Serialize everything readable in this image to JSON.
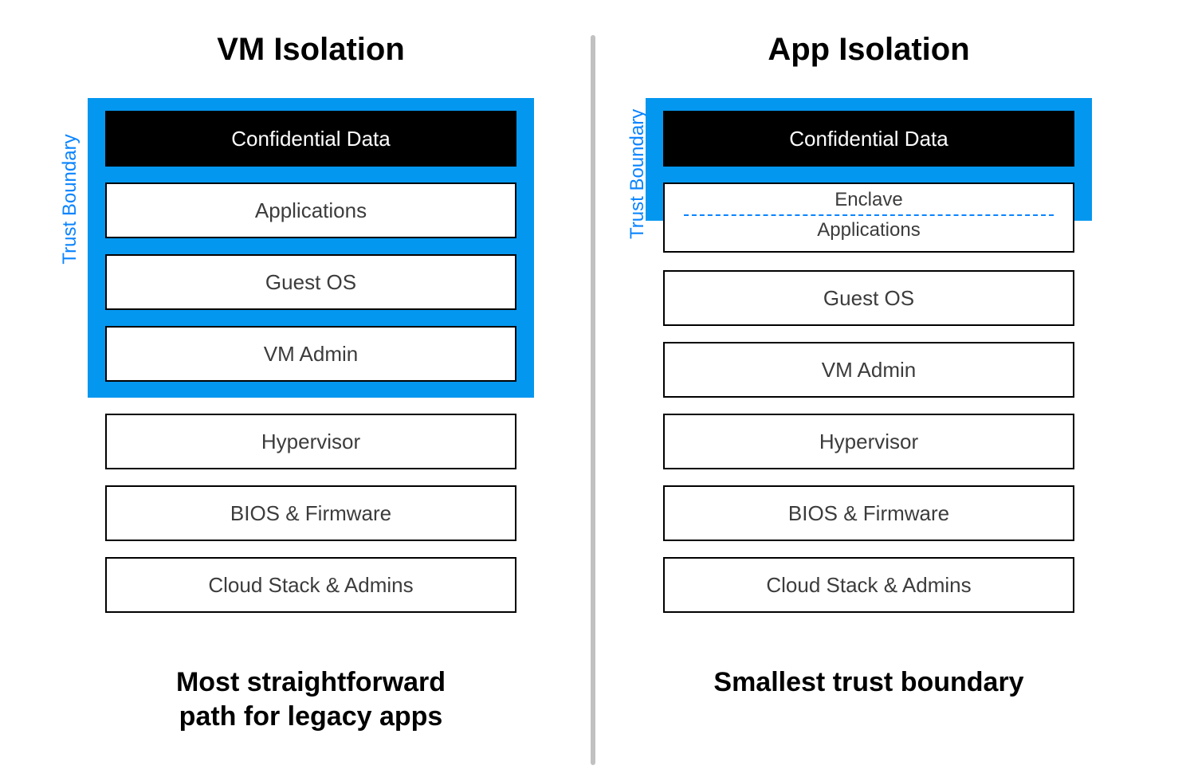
{
  "left": {
    "title": "VM Isolation",
    "trust_label": "Trust Boundary",
    "layers": {
      "confidential": "Confidential Data",
      "apps": "Applications",
      "guest": "Guest OS",
      "vmadmin": "VM Admin",
      "hyperv": "Hypervisor",
      "bios": "BIOS & Firmware",
      "cloud": "Cloud Stack & Admins"
    },
    "caption_line1": "Most straightforward",
    "caption_line2": "path for legacy apps"
  },
  "right": {
    "title": "App Isolation",
    "trust_label": "Trust Boundary",
    "layers": {
      "confidential": "Confidential Data",
      "enclave": "Enclave",
      "apps": "Applications",
      "guest": "Guest OS",
      "vmadmin": "VM Admin",
      "hyperv": "Hypervisor",
      "bios": "BIOS & Firmware",
      "cloud": "Cloud Stack & Admins"
    },
    "caption_line1": "Smallest trust boundary"
  },
  "colors": {
    "trust_boundary": "#0497ef",
    "trust_label": "#0a84ff",
    "divider": "#c1c1c1"
  }
}
